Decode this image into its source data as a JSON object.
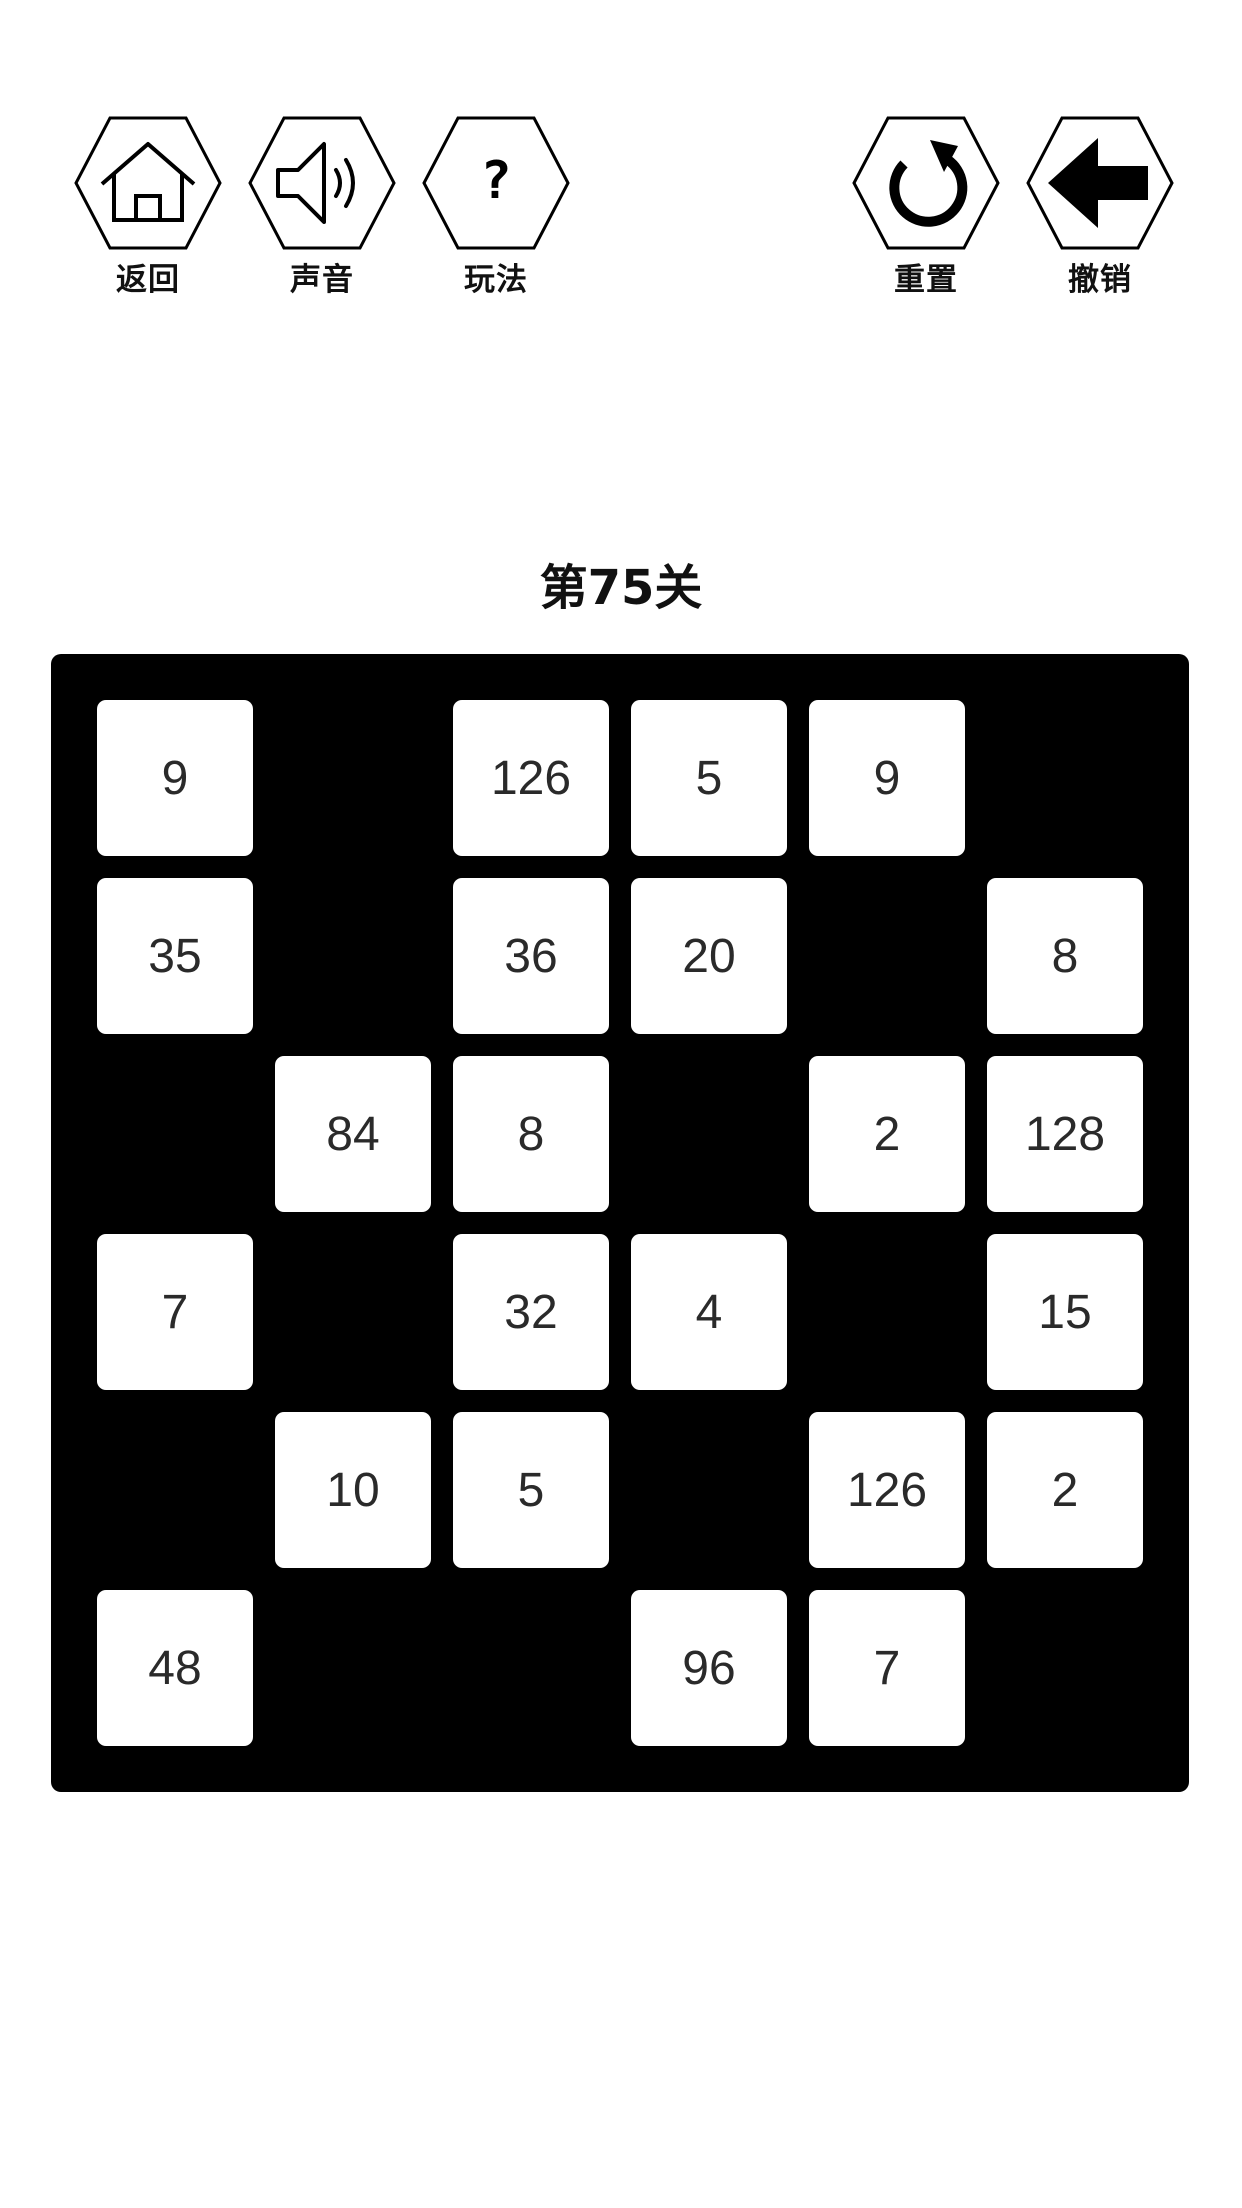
{
  "toolbar": {
    "back_label": "返回",
    "sound_label": "声音",
    "help_label": "玩法",
    "help_glyph": "?",
    "reset_label": "重置",
    "undo_label": "撤销"
  },
  "level": {
    "title": "第75关"
  },
  "colors": {
    "board": "#000000",
    "tile": "#ffffff",
    "text": "#111111",
    "background": "#ffffff"
  },
  "board": {
    "rows": 6,
    "cols": 6,
    "cells": [
      [
        "9",
        "",
        "126",
        "5",
        "9",
        ""
      ],
      [
        "35",
        "",
        "36",
        "20",
        "",
        "8"
      ],
      [
        "",
        "84",
        "8",
        "",
        "2",
        "128"
      ],
      [
        "7",
        "",
        "32",
        "4",
        "",
        "15"
      ],
      [
        "",
        "10",
        "5",
        "",
        "126",
        "2"
      ],
      [
        "48",
        "",
        "",
        "96",
        "7",
        ""
      ]
    ]
  }
}
